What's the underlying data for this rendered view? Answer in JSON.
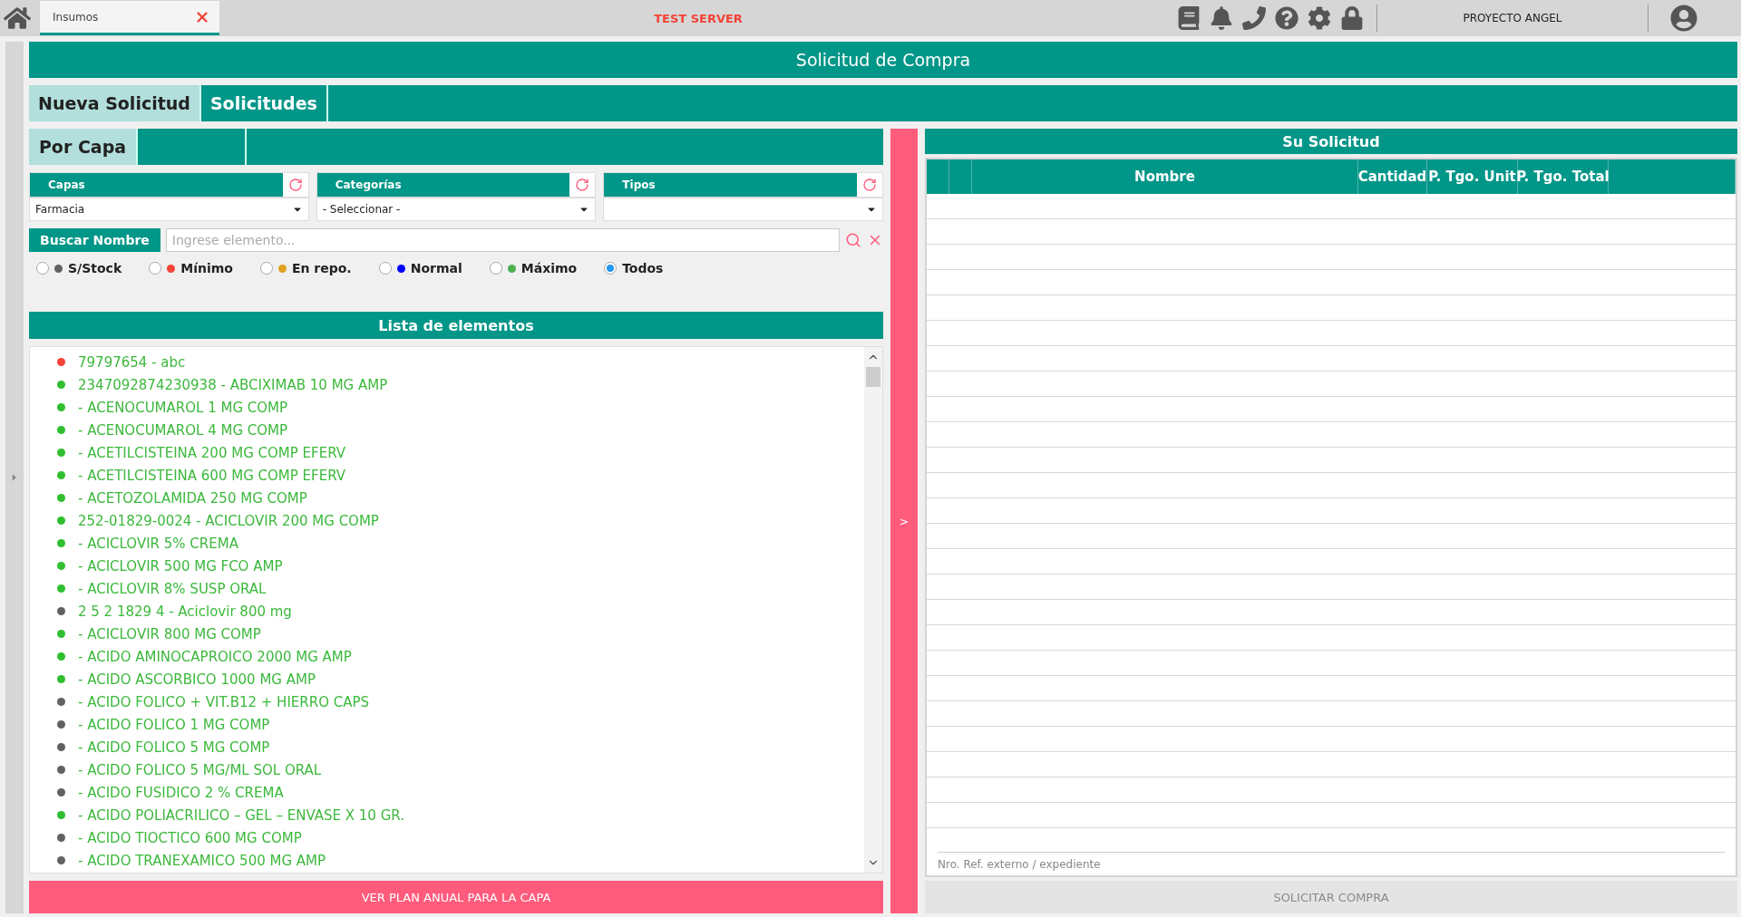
{
  "top_bar": {
    "tabs": [
      {
        "label": "Insumos",
        "selected": true
      }
    ],
    "server_label": "TEST SERVER",
    "project": "PROYECTO ANGEL"
  },
  "title": "Solicitud de Compra",
  "main_tabs": [
    {
      "label": "Nueva Solicitud",
      "selected": true
    },
    {
      "label": "Solicitudes",
      "selected": false
    }
  ],
  "sub_tabs": [
    {
      "label": "Por Capa",
      "selected": true
    },
    {
      "selected": false
    }
  ],
  "filters": [
    {
      "label": "Capas",
      "value": "Farmacia"
    },
    {
      "label": "Categorías",
      "value": "- Seleccionar -"
    },
    {
      "label": "Tipos"
    }
  ],
  "search": {
    "button": "Buscar Nombre",
    "placeholder": "Ingrese elemento..."
  },
  "stock_filters": [
    {
      "label": "S/Stock",
      "color": "#616161",
      "selected": false
    },
    {
      "label": "Mínimo",
      "color": "#f44336",
      "selected": false
    },
    {
      "label": "En repo.",
      "color": "#e0a020",
      "selected": false
    },
    {
      "label": "Normal",
      "color": "#0000ff",
      "selected": false
    },
    {
      "label": "Máximo",
      "color": "#4caf50",
      "selected": false
    },
    {
      "label": "Todos",
      "selected": true
    }
  ],
  "list": {
    "title": "Lista de elementos",
    "items": [
      {
        "text": "79797654 - abc",
        "color": "#f44336"
      },
      {
        "text": "2347092874230938 - ABCIXIMAB 10 MG AMP",
        "color": "#2fbf2f"
      },
      {
        "text": "- ACENOCUMAROL 1 MG COMP",
        "color": "#2fbf2f"
      },
      {
        "text": "- ACENOCUMAROL 4 MG COMP",
        "color": "#2fbf2f"
      },
      {
        "text": "- ACETILCISTEINA 200 MG COMP EFERV",
        "color": "#2fbf2f"
      },
      {
        "text": "- ACETILCISTEINA 600 MG COMP EFERV",
        "color": "#2fbf2f"
      },
      {
        "text": "- ACETOZOLAMIDA 250 MG COMP",
        "color": "#2fbf2f"
      },
      {
        "text": "252-01829-0024 - ACICLOVIR 200 MG COMP",
        "color": "#2fbf2f"
      },
      {
        "text": "- ACICLOVIR 5% CREMA",
        "color": "#2fbf2f"
      },
      {
        "text": "- ACICLOVIR 500 MG FCO AMP",
        "color": "#2fbf2f"
      },
      {
        "text": "- ACICLOVIR 8% SUSP ORAL",
        "color": "#2fbf2f"
      },
      {
        "text": "2 5 2 1829 4 - Aciclovir 800 mg",
        "color": "#616161"
      },
      {
        "text": "- ACICLOVIR 800 MG COMP",
        "color": "#2fbf2f"
      },
      {
        "text": "- ACIDO AMINOCAPROICO 2000 MG AMP",
        "color": "#2fbf2f"
      },
      {
        "text": "- ACIDO ASCORBICO 1000 MG AMP",
        "color": "#2fbf2f"
      },
      {
        "text": "- ACIDO FOLICO + VIT.B12 + HIERRO CAPS",
        "color": "#616161"
      },
      {
        "text": "- ACIDO FOLICO 1 MG COMP",
        "color": "#616161"
      },
      {
        "text": "- ACIDO FOLICO 5 MG COMP",
        "color": "#616161"
      },
      {
        "text": "- ACIDO FOLICO 5 MG/ML SOL ORAL",
        "color": "#616161"
      },
      {
        "text": "- ACIDO FUSIDICO 2 % CREMA",
        "color": "#616161"
      },
      {
        "text": "- ACIDO POLIACRILICO – GEL – ENVASE X 10 GR.",
        "color": "#2fbf2f"
      },
      {
        "text": "- ACIDO TIOCTICO 600 MG COMP",
        "color": "#616161"
      },
      {
        "text": "- ACIDO TRANEXAMICO 500 MG AMP",
        "color": "#616161"
      }
    ]
  },
  "plan_button": "VER PLAN ANUAL PARA LA CAPA",
  "transfer_button": ">",
  "request": {
    "title": "Su Solicitud",
    "columns": [
      "",
      "",
      "Nombre",
      "Cantidad",
      "P. Tgo. Unit",
      "P. Tgo. Total",
      ""
    ],
    "reference_placeholder": "Nro. Ref. externo / expediente",
    "submit": {
      "label": "SOLICITAR COMPRA",
      "disabled": true
    }
  }
}
